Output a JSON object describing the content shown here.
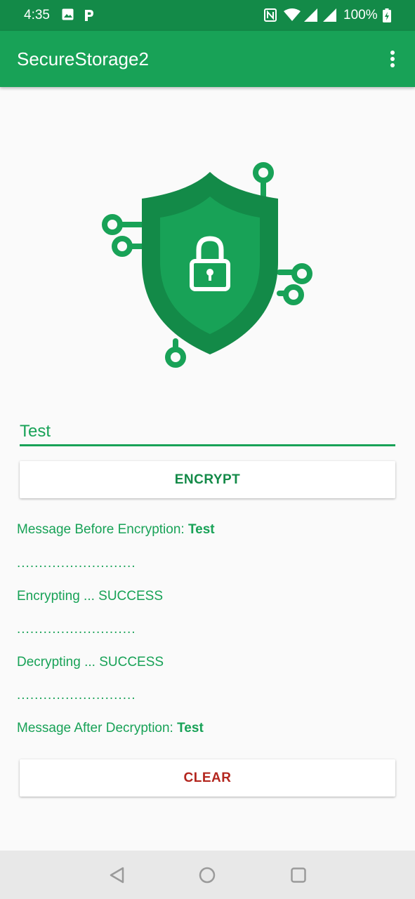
{
  "status_bar": {
    "time": "4:35",
    "battery": "100%",
    "icons": [
      "image-icon",
      "p-app-icon",
      "nfc-icon",
      "wifi-icon",
      "signal-icon",
      "signal-icon",
      "battery-charging-icon"
    ]
  },
  "app_bar": {
    "title": "SecureStorage2",
    "menu_icon": "more-vert-icon"
  },
  "hero": {
    "icon": "shield-lock-circuit-icon"
  },
  "input": {
    "value": "Test"
  },
  "encrypt_button": {
    "label": "ENCRYPT"
  },
  "log": {
    "before_label": "Message Before Encryption: ",
    "before_value": "Test",
    "separator_1": "...........................",
    "encrypting": "Encrypting ... SUCCESS",
    "separator_2": "...........................",
    "decrypting": "Decrypting ... SUCCESS",
    "separator_3": "...........................",
    "after_label": "Message After Decryption: ",
    "after_value": "Test"
  },
  "clear_button": {
    "label": "CLEAR"
  },
  "nav_bar": {
    "icons": [
      "back-icon",
      "home-icon",
      "recents-icon"
    ]
  },
  "colors": {
    "status_bar": "#138a48",
    "app_bar": "#18a257",
    "accent": "#18a257",
    "shield_dark": "#138a48",
    "clear_text": "#b3261e"
  }
}
